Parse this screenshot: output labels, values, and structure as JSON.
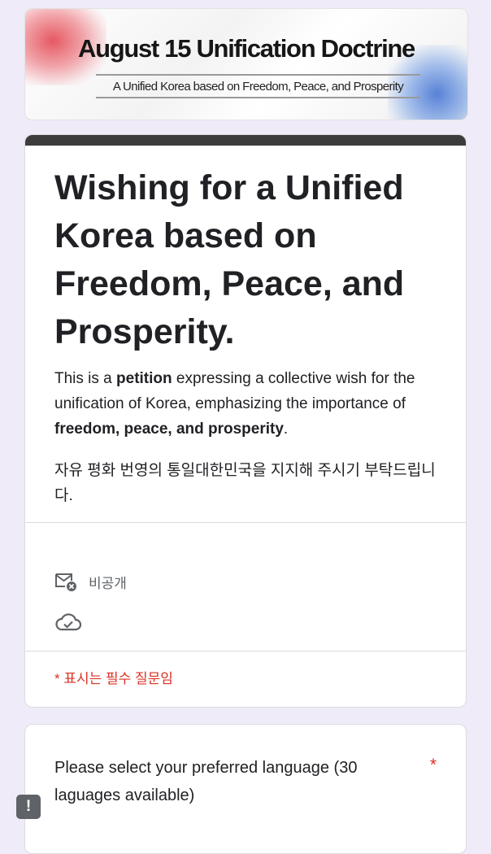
{
  "banner": {
    "title": "August 15 Unification Doctrine",
    "subtitle": "A Unified Korea based on Freedom, Peace, and Prosperity"
  },
  "form": {
    "title": "Wishing for a Unified Korea based on Freedom, Peace, and Prosperity.",
    "description": {
      "part1": "This is a ",
      "bold1": "petition",
      "part2": " expressing a collective wish for the unification of Korea, emphasizing the importance of ",
      "bold2": "freedom, peace, and prosperity",
      "part3": "."
    },
    "description_ko": "자유 평화 번영의 통일대한민국을 지지해 주시기 부탁드립니다.",
    "privacy_label": "비공개",
    "privacy_icon": "mail-off-icon",
    "cloud_icon": "cloud-check-icon",
    "required_note": "* 표시는 필수 질문임"
  },
  "question": {
    "text": "Please select your preferred language (30 laguages available)",
    "required_mark": "*"
  },
  "feedback_button": {
    "label": "!"
  },
  "colors": {
    "header_bar": "#3c3c3c",
    "required": "#d93025",
    "background": "#f0ebf8"
  }
}
